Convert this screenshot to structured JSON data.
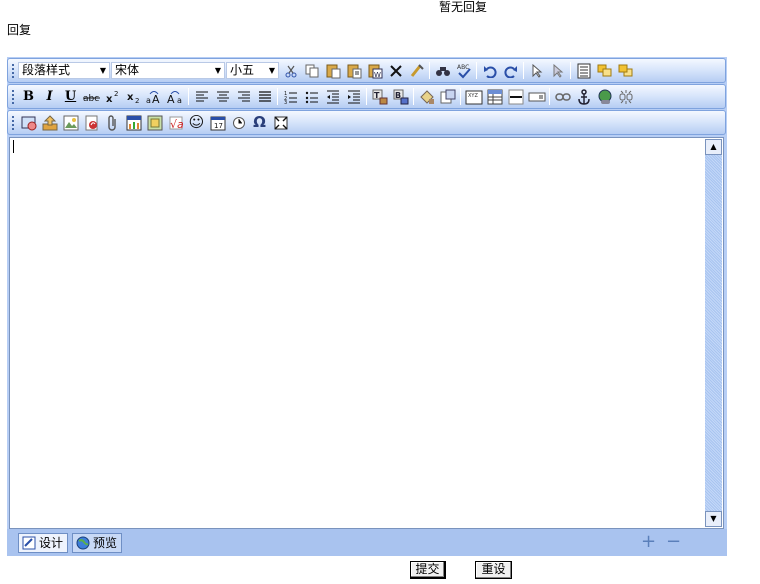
{
  "header": {
    "no_reply_text": "暂无回复"
  },
  "form": {
    "reply_label": "回复"
  },
  "editor": {
    "paragraph_style": "段落样式",
    "font_family": "宋体",
    "font_size": "小五",
    "content": "",
    "mode_tabs": [
      {
        "label": "设计",
        "icon": "design-icon",
        "active": true
      },
      {
        "label": "预览",
        "icon": "preview-globe-icon",
        "active": false
      }
    ],
    "zoom_in_symbol": "+",
    "zoom_out_symbol": "−"
  },
  "buttons": {
    "submit": "提交",
    "reset": "重设"
  },
  "colors": {
    "toolbar_border": "#7fa3de",
    "editor_frame": "#b7cef5",
    "bottom_bar": "#a9c3ef"
  },
  "toolbar_icons": {
    "row1": [
      "cut-icon",
      "copy-icon",
      "paste-icon",
      "paste-text-icon",
      "paste-word-icon",
      "delete-icon",
      "clean-format-icon",
      "find-icon",
      "spellcheck-icon",
      "undo-icon",
      "redo-icon",
      "select-icon",
      "select-all-icon",
      "page-properties-icon",
      "bring-forward-icon",
      "send-backward-icon"
    ],
    "row2": [
      "bold-icon",
      "italic-icon",
      "underline-icon",
      "strikethrough-icon",
      "superscript-icon",
      "subscript-icon",
      "uppercase-icon",
      "lowercase-icon",
      "align-left-icon",
      "align-center-icon",
      "align-right-icon",
      "align-justify-icon",
      "ordered-list-icon",
      "unordered-list-icon",
      "outdent-icon",
      "indent-icon",
      "text-color-icon",
      "background-color-icon",
      "format-brush-icon",
      "insert-block-icon",
      "insert-field-icon",
      "insert-table-icon",
      "horizontal-rule-icon",
      "insert-input-icon",
      "link-icon",
      "anchor-icon",
      "hyperlink-icon",
      "unlink-icon"
    ],
    "row3": [
      "insert-media-icon",
      "upload-icon",
      "insert-image-icon",
      "insert-flash-icon",
      "attachment-icon",
      "insert-chart-icon",
      "insert-picture-icon",
      "formula-icon",
      "emoticon-icon",
      "insert-date-icon",
      "insert-time-icon",
      "special-char-icon",
      "fullscreen-icon"
    ],
    "special_char_symbol": "Ω",
    "emoticon_symbol": "☺"
  }
}
